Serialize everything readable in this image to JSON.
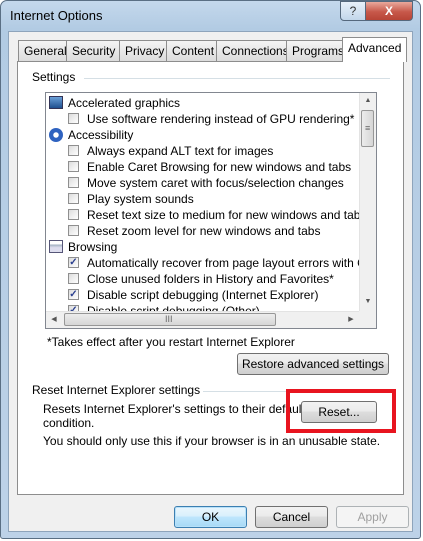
{
  "window": {
    "title": "Internet Options",
    "help_label": "?",
    "close_label": "X"
  },
  "tabs": [
    {
      "label": "General",
      "active": false
    },
    {
      "label": "Security",
      "active": false
    },
    {
      "label": "Privacy",
      "active": false
    },
    {
      "label": "Content",
      "active": false
    },
    {
      "label": "Connections",
      "active": false
    },
    {
      "label": "Programs",
      "active": false
    },
    {
      "label": "Advanced",
      "active": true
    }
  ],
  "settings": {
    "section_label": "Settings",
    "items": [
      {
        "label": "Accelerated graphics",
        "type": "category",
        "icon": "monitor-icon"
      },
      {
        "label": "Use software rendering instead of GPU rendering*",
        "type": "checkbox",
        "checked": false
      },
      {
        "label": "Accessibility",
        "type": "category",
        "icon": "accessibility-icon"
      },
      {
        "label": "Always expand ALT text for images",
        "type": "checkbox",
        "checked": false
      },
      {
        "label": "Enable Caret Browsing for new windows and tabs",
        "type": "checkbox",
        "checked": false
      },
      {
        "label": "Move system caret with focus/selection changes",
        "type": "checkbox",
        "checked": false
      },
      {
        "label": "Play system sounds",
        "type": "checkbox",
        "checked": false
      },
      {
        "label": "Reset text size to medium for new windows and tabs",
        "type": "checkbox",
        "checked": false
      },
      {
        "label": "Reset zoom level for new windows and tabs",
        "type": "checkbox",
        "checked": false
      },
      {
        "label": "Browsing",
        "type": "category",
        "icon": "browsing-icon"
      },
      {
        "label": "Automatically recover from page layout errors with Compa",
        "type": "checkbox",
        "checked": true
      },
      {
        "label": "Close unused folders in History and Favorites*",
        "type": "checkbox",
        "checked": false
      },
      {
        "label": "Disable script debugging (Internet Explorer)",
        "type": "checkbox",
        "checked": true
      },
      {
        "label": "Disable script debugging (Other)",
        "type": "checkbox",
        "checked": true
      }
    ],
    "footnote": "*Takes effect after you restart Internet Explorer",
    "restore_button": "Restore advanced settings"
  },
  "reset": {
    "section_label": "Reset Internet Explorer settings",
    "description_line1": "Resets Internet Explorer's settings to their default",
    "description_line2": "condition.",
    "button": "Reset...",
    "warning": "You should only use this if your browser is in an unusable state."
  },
  "footer": {
    "ok": "OK",
    "cancel": "Cancel",
    "apply": "Apply"
  },
  "scrollbar": {
    "up_arrow": "▲",
    "down_arrow": "▼",
    "left_arrow": "◀",
    "right_arrow": "▶",
    "grip": "III",
    "v_grip": "≡"
  },
  "colors": {
    "highlight": "#e8141f",
    "check": "#2a3f8f"
  }
}
